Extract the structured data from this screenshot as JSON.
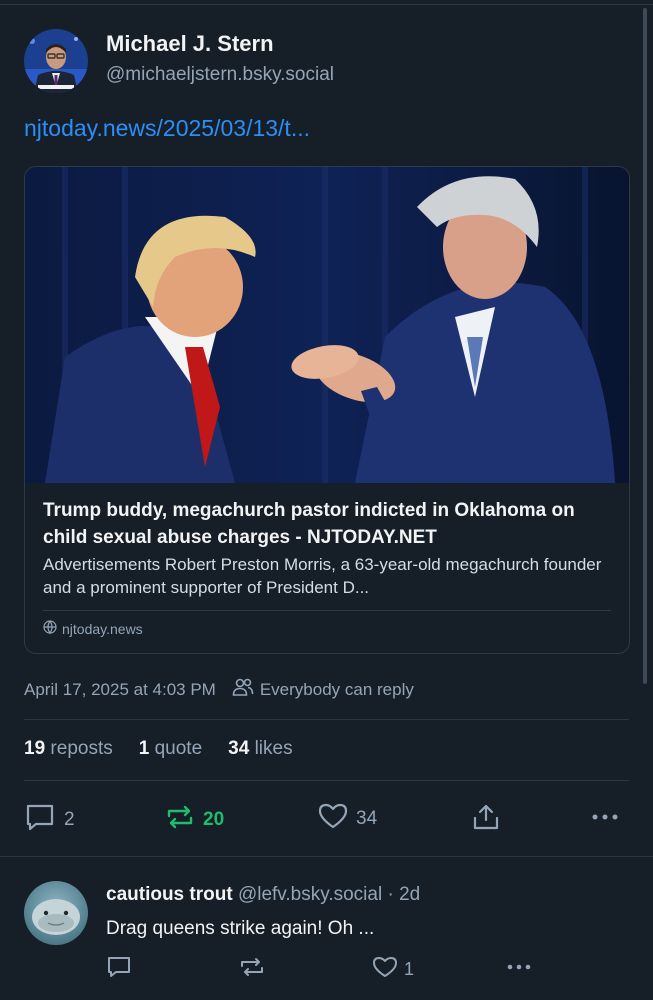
{
  "post": {
    "author": {
      "name": "Michael J. Stern",
      "handle": "@michaeljstern.bsky.social"
    },
    "link_text": "njtoday.news/2025/03/13/t...",
    "embed": {
      "title": "Trump buddy, megachurch pastor indicted in Oklahoma on child sexual abuse charges - NJTODAY.NET",
      "description": "Advertisements Robert Preston Morris, a 63-year-old megachurch founder and a prominent supporter of President D...",
      "domain": "njtoday.news"
    },
    "timestamp": "April 17, 2025 at 4:03 PM",
    "reply_setting": "Everybody can reply",
    "stats": {
      "reposts_count": "19",
      "reposts_label": "reposts",
      "quotes_count": "1",
      "quotes_label": "quote",
      "likes_count": "34",
      "likes_label": "likes"
    },
    "actions": {
      "reply_count": "2",
      "repost_count": "20",
      "like_count": "34"
    }
  },
  "reply": {
    "author_name": "cautious trout",
    "author_handle": "@lefv.bsky.social",
    "separator": "·",
    "age": "2d",
    "text": "Drag queens strike again! Oh ...",
    "like_count": "1"
  },
  "colors": {
    "background": "#161e27",
    "link": "#2c8ef7",
    "repost_active": "#20bc6e",
    "muted": "#93a5b7"
  },
  "icons": [
    "reply-icon",
    "repost-icon",
    "like-icon",
    "share-icon",
    "more-icon",
    "globe-icon",
    "people-icon"
  ]
}
